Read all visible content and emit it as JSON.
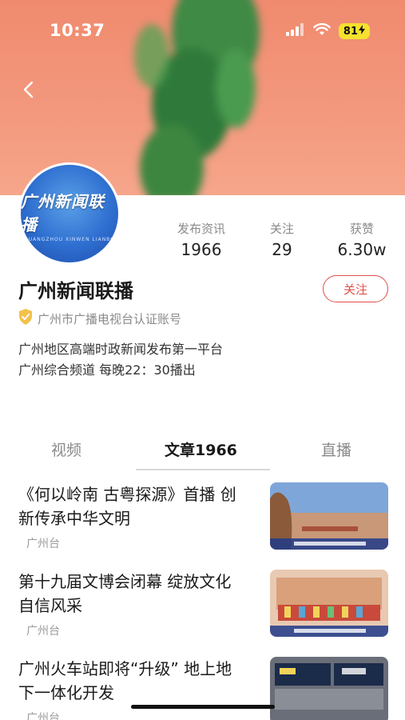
{
  "status_bar": {
    "time": "10:37",
    "battery": "81"
  },
  "icons": {
    "back": "chevron-left-icon",
    "signal": "cellular-signal-icon",
    "wifi": "wifi-icon",
    "charging": "charging-bolt-icon",
    "verified": "verified-shield-icon"
  },
  "profile": {
    "avatar_title": "广州新闻联播",
    "avatar_subtitle": "GUANGZHOU XINWEN LIANBO",
    "name": "广州新闻联播",
    "follow_label": "关注",
    "verification": "广州市广播电视台认证账号",
    "bio_line1": "广州地区高端时政新闻发布第一平台",
    "bio_line2": "广州综合频道 每晚22：30播出"
  },
  "stats": {
    "posts": {
      "label": "发布资讯",
      "value": "1966"
    },
    "following": {
      "label": "关注",
      "value": "29"
    },
    "likes": {
      "label": "获赞",
      "value": "6.30w"
    }
  },
  "tabs": [
    {
      "label": "视频"
    },
    {
      "label": "文章1966",
      "active": true
    },
    {
      "label": "直播"
    }
  ],
  "articles": [
    {
      "title_line1": "《何以岭南 古粤探源》首播 创",
      "title_line2": "新传承中华文明",
      "source": "广州台"
    },
    {
      "title_line1": "第十九届文博会闭幕 绽放文化",
      "title_line2": "自信风采",
      "source": "广州台"
    },
    {
      "title_line1": "广州火车站即将“升级” 地上地",
      "title_line2": "下一体化开发",
      "source": "广州台"
    }
  ],
  "colors": {
    "header_bg": "#f08a6e",
    "accent_red": "#e0504a",
    "avatar_blue": "#2f6fd0",
    "battery_yellow": "#f5e12e"
  }
}
